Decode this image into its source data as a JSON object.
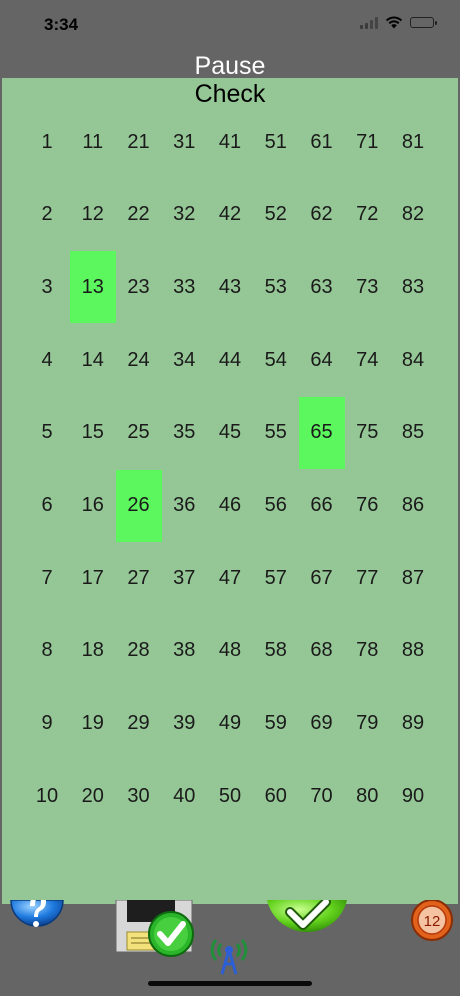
{
  "status": {
    "time": "3:34"
  },
  "header": {
    "pause_label": "Pause",
    "check_label": "Check"
  },
  "grid": {
    "columns": [
      [
        "1",
        "2",
        "3",
        "4",
        "5",
        "6",
        "7",
        "8",
        "9",
        "10"
      ],
      [
        "11",
        "12",
        "13",
        "14",
        "15",
        "16",
        "17",
        "18",
        "19",
        "20"
      ],
      [
        "21",
        "22",
        "23",
        "24",
        "25",
        "26",
        "27",
        "28",
        "29",
        "30"
      ],
      [
        "31",
        "32",
        "33",
        "34",
        "35",
        "36",
        "37",
        "38",
        "39",
        "40"
      ],
      [
        "41",
        "42",
        "43",
        "44",
        "45",
        "46",
        "47",
        "48",
        "49",
        "50"
      ],
      [
        "51",
        "52",
        "53",
        "54",
        "55",
        "56",
        "57",
        "58",
        "59",
        "60"
      ],
      [
        "61",
        "62",
        "63",
        "64",
        "65",
        "66",
        "67",
        "68",
        "69",
        "70"
      ],
      [
        "71",
        "72",
        "73",
        "74",
        "75",
        "76",
        "77",
        "78",
        "79",
        "80"
      ],
      [
        "81",
        "82",
        "83",
        "84",
        "85",
        "86",
        "87",
        "88",
        "89",
        "90"
      ]
    ],
    "highlighted": [
      "13",
      "26",
      "65"
    ]
  },
  "toolbar": {
    "help_icon": "help-question-icon",
    "save_icon": "save-check-icon",
    "broadcast_icon": "broadcast-antenna-icon",
    "check_icon": "big-green-check-icon",
    "timer_icon": "timer-12-icon",
    "timer_value": "12"
  },
  "colors": {
    "board_bg": "#95c796",
    "highlight": "#5cf75e",
    "frame_bg": "#656565"
  }
}
